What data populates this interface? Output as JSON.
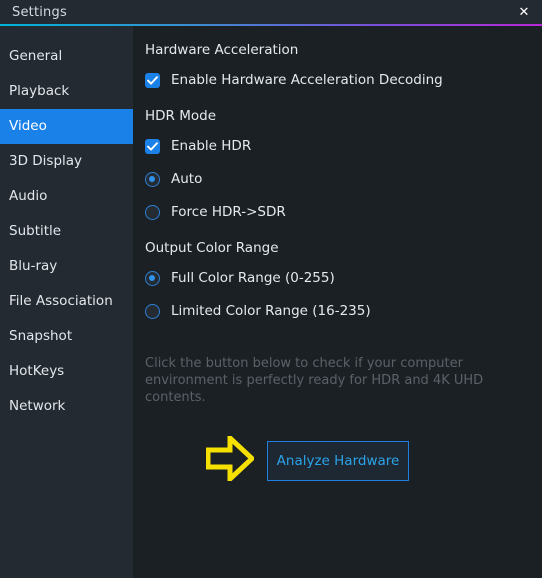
{
  "window": {
    "title": "Settings",
    "close_label": "✕",
    "accent_gradient_start": "#00b4d8",
    "accent_gradient_end": "#b829d9",
    "sidebar_bg": "#242a31",
    "content_bg": "#1b2025",
    "accent_blue": "#1a81e8"
  },
  "sidebar": {
    "items": [
      {
        "label": "General",
        "selected": false
      },
      {
        "label": "Playback",
        "selected": false
      },
      {
        "label": "Video",
        "selected": true
      },
      {
        "label": "3D Display",
        "selected": false
      },
      {
        "label": "Audio",
        "selected": false
      },
      {
        "label": "Subtitle",
        "selected": false
      },
      {
        "label": "Blu-ray",
        "selected": false
      },
      {
        "label": "File Association",
        "selected": false
      },
      {
        "label": "Snapshot",
        "selected": false
      },
      {
        "label": "HotKeys",
        "selected": false
      },
      {
        "label": "Network",
        "selected": false
      }
    ]
  },
  "content": {
    "hardware_acceleration": {
      "title": "Hardware Acceleration",
      "checkbox_label": "Enable Hardware Acceleration Decoding",
      "checked": true
    },
    "hdr_mode": {
      "title": "HDR Mode",
      "checkbox_label": "Enable HDR",
      "checked": true,
      "options": [
        {
          "label": "Auto",
          "selected": true
        },
        {
          "label": "Force HDR->SDR",
          "selected": false
        }
      ]
    },
    "output_color_range": {
      "title": "Output Color Range",
      "options": [
        {
          "label": "Full Color Range (0-255)",
          "selected": true
        },
        {
          "label": "Limited Color Range (16-235)",
          "selected": false
        }
      ]
    },
    "hint": "Click the button below to check if your computer environment is perfectly ready for HDR and 4K UHD contents.",
    "analyze_button_label": "Analyze Hardware",
    "pointer_arrow_color": "#f5e000"
  }
}
